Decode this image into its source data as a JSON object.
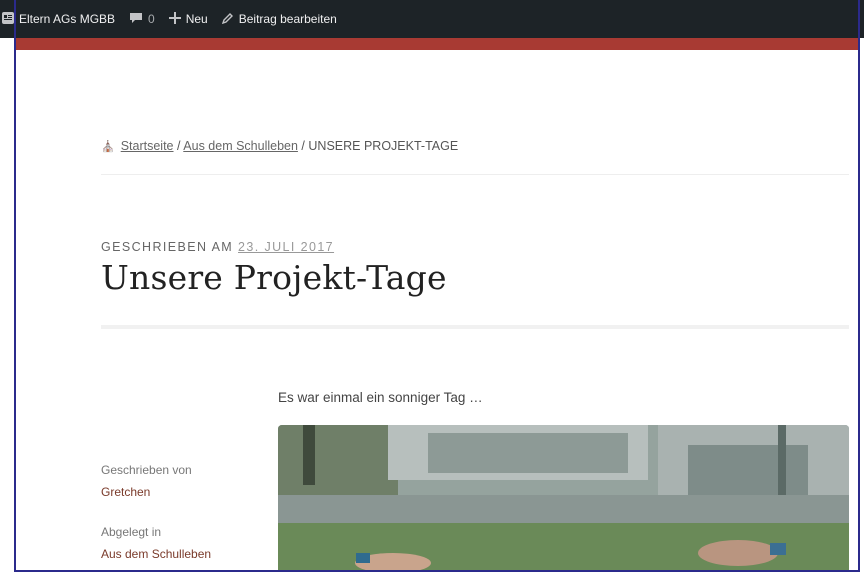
{
  "adminbar": {
    "site_name": "Eltern AGs MGBB",
    "comments_count": "0",
    "new_label": "Neu",
    "edit_label": "Beitrag bearbeiten"
  },
  "breadcrumb": {
    "home": "Startseite",
    "sep1": "/",
    "category": "Aus dem Schulleben",
    "sep2": "/",
    "current": "UNSERE PROJEKT-TAGE"
  },
  "post": {
    "written_on_label": "GESCHRIEBEN AM",
    "date": "23. JULI 2017",
    "title": "Unsere Projekt-Tage",
    "intro": "Es war einmal ein sonniger Tag …"
  },
  "meta": {
    "author_label": "Geschrieben von",
    "author": "Gretchen",
    "category_label": "Abgelegt in",
    "category": "Aus dem Schulleben"
  },
  "icons": {
    "site": "wordpress-icon",
    "comments": "comment-bubble-icon",
    "new": "plus-icon",
    "edit": "pencil-icon",
    "home": "home-icon"
  },
  "colors": {
    "adminbar_bg": "#1d2327",
    "accent_red": "#a83a33",
    "meta_link": "#7a3a2a",
    "frame_border": "#2b2a8c"
  }
}
